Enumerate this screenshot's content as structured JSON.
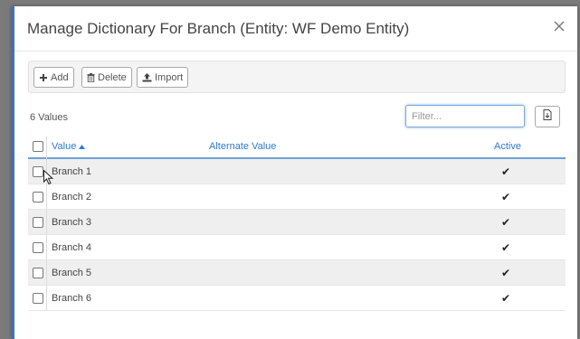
{
  "dialog": {
    "title": "Manage Dictionary For Branch (Entity: WF Demo Entity)"
  },
  "toolbar": {
    "add_label": "Add",
    "delete_label": "Delete",
    "import_label": "Import"
  },
  "summary": {
    "values_count": "6 Values"
  },
  "filter": {
    "placeholder": "Filter..."
  },
  "grid": {
    "columns": {
      "value": "Value",
      "alternate_value": "Alternate Value",
      "active": "Active"
    },
    "rows": [
      {
        "value": "Branch 1",
        "alternate_value": "",
        "active": "✔"
      },
      {
        "value": "Branch 2",
        "alternate_value": "",
        "active": "✔"
      },
      {
        "value": "Branch 3",
        "alternate_value": "",
        "active": "✔"
      },
      {
        "value": "Branch 4",
        "alternate_value": "",
        "active": "✔"
      },
      {
        "value": "Branch 5",
        "alternate_value": "",
        "active": "✔"
      },
      {
        "value": "Branch 6",
        "alternate_value": "",
        "active": "✔"
      }
    ]
  },
  "colors": {
    "accent": "#2f7ad3",
    "modal_border": "#3f73b5",
    "row_stripe": "#efefef"
  }
}
